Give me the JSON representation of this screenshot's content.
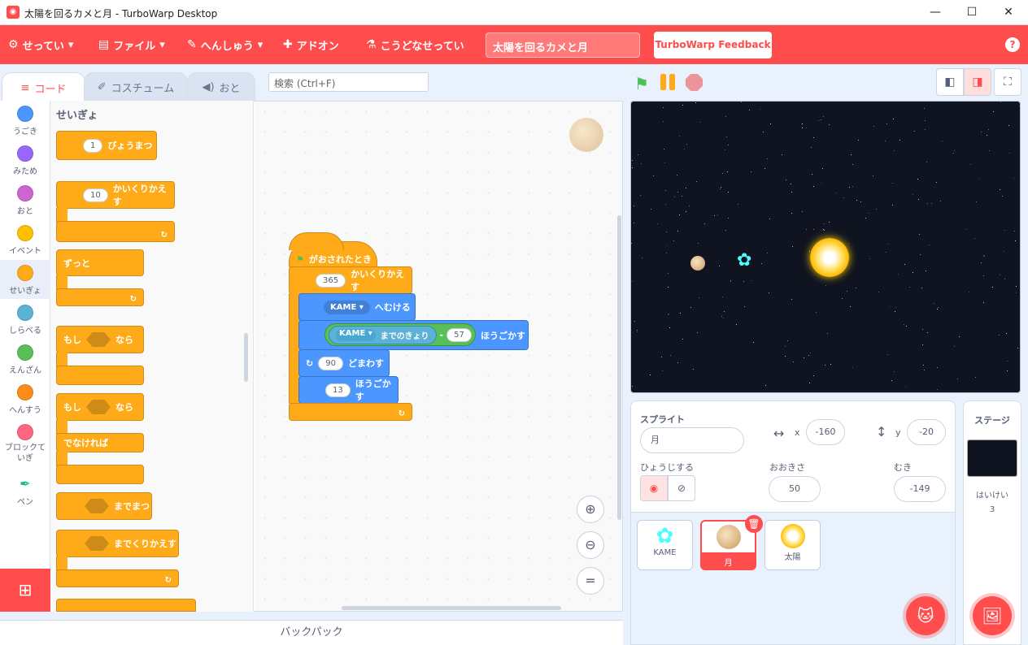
{
  "window": {
    "title": "太陽を回るカメと月 - TurboWarp Desktop",
    "minimize": "—",
    "maximize": "☐",
    "close": "✕"
  },
  "menu": {
    "settings": "せってい",
    "file": "ファイル",
    "edit": "へんしゅう",
    "addons": "アドオン",
    "tutorials": "こうどなせってい",
    "project_title": "太陽を回るカメと月",
    "feedback": "TurboWarp Feedback",
    "help": "?"
  },
  "tabs": {
    "code": "コード",
    "costumes": "コスチューム",
    "sounds": "おと"
  },
  "search": {
    "placeholder": "検索 (Ctrl+F)"
  },
  "categories": [
    {
      "label": "うごき",
      "color": "#4c97ff"
    },
    {
      "label": "みため",
      "color": "#9966ff"
    },
    {
      "label": "おと",
      "color": "#cf63cf"
    },
    {
      "label": "イベント",
      "color": "#ffbf00"
    },
    {
      "label": "せいぎょ",
      "color": "#ffab19"
    },
    {
      "label": "しらべる",
      "color": "#5cb1d6"
    },
    {
      "label": "えんざん",
      "color": "#59c059"
    },
    {
      "label": "へんすう",
      "color": "#ff8c1a"
    },
    {
      "label": "ブロックていぎ",
      "color": "#ff6680"
    },
    {
      "label": "ペン",
      "color": "#0fbd8c"
    }
  ],
  "palette": {
    "title": "せいぎょ",
    "wait": {
      "value": "1",
      "label": "びょうまつ"
    },
    "repeat": {
      "value": "10",
      "label": "かいくりかえす"
    },
    "forever": "ずっと",
    "if_then": {
      "if": "もし",
      "then": "なら"
    },
    "if_else": {
      "if": "もし",
      "then": "なら",
      "else": "でなければ"
    },
    "wait_until": "までまつ",
    "repeat_until": "までくりかえす"
  },
  "script": {
    "hat": "がおされたとき",
    "repeat_value": "365",
    "repeat_label": "かいくりかえす",
    "point_target": "KAME",
    "point_label": "へむける",
    "dist_target": "KAME",
    "dist_label": "までのきょり",
    "minus": "-",
    "minus_value": "57",
    "move_label": "ほうごかす",
    "turn_value": "90",
    "turn_label": "どまわす",
    "move2_value": "13",
    "move2_label": "ほうごかす"
  },
  "backpack": "バックパック",
  "sprite_info": {
    "sprite_label": "スプライト",
    "sprite_name": "月",
    "x_label": "x",
    "x_value": "-160",
    "y_label": "y",
    "y_value": "-20",
    "show_label": "ひょうじする",
    "size_label": "おおきさ",
    "size_value": "50",
    "direction_label": "むき",
    "direction_value": "-149"
  },
  "sprites": [
    {
      "name": "KAME",
      "color": "#4dfcff"
    },
    {
      "name": "月",
      "color": "#d9b88a"
    },
    {
      "name": "太陽",
      "color": "#ffd84d"
    }
  ],
  "stage_panel": {
    "label": "ステージ",
    "backdrops_label": "はいけい",
    "backdrops_count": "3"
  }
}
